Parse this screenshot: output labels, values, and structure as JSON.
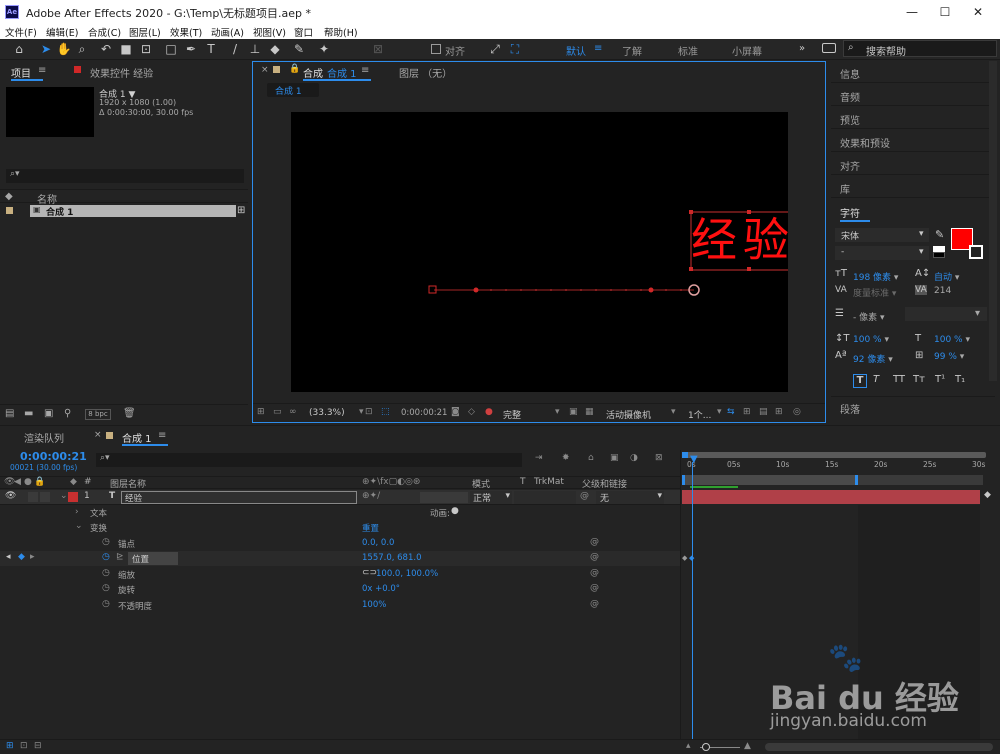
{
  "window": {
    "title": "Adobe After Effects 2020 - G:\\Temp\\无标题项目.aep *",
    "min": "—",
    "max": "☐",
    "close": "✕"
  },
  "menu": [
    "文件(F)",
    "编辑(E)",
    "合成(C)",
    "图层(L)",
    "效果(T)",
    "动画(A)",
    "视图(V)",
    "窗口",
    "帮助(H)"
  ],
  "toolbar": {
    "align_label": "对齐",
    "workspaces": [
      "默认",
      "了解",
      "标准",
      "小屏幕"
    ],
    "active_ws": "默认",
    "more": "»",
    "search_placeholder": "搜索帮助"
  },
  "project": {
    "tab": "项目",
    "tab2": "效果控件 经验",
    "comp_name": "合成 1 ▼",
    "comp_res": "1920 x 1080 (1.00)",
    "comp_dur": "Δ 0:00:30:00, 30.00 fps",
    "col_name": "名称",
    "item": "合成 1",
    "bpc": "8 bpc"
  },
  "comp": {
    "tab": "合成",
    "tab_name": "合成 1",
    "layer_tab": "图层 （无）",
    "breadcrumb": "合成 1",
    "text": "经验",
    "zoom": "(33.3%)",
    "timecode": "0:00:00:21",
    "quality": "完整",
    "camera": "活动摄像机",
    "views": "1个..."
  },
  "right_panels": [
    "信息",
    "音频",
    "预览",
    "效果和预设",
    "对齐",
    "库"
  ],
  "character": {
    "title": "字符",
    "font": "宋体",
    "style": "-",
    "size": "198 像素",
    "leading": "自动",
    "kerning": "度量标准",
    "tracking": "214",
    "stroke": "- 像素",
    "vscale": "100 %",
    "hscale": "100 %",
    "baseline": "92 像素",
    "tsume": "99 %",
    "fill_color": "#ff0000",
    "styles": [
      "T",
      "T",
      "TT",
      "Tт",
      "T¹",
      "T₁"
    ]
  },
  "paragraph": {
    "title": "段落"
  },
  "timeline": {
    "tab_render": "渲染队列",
    "tab_comp": "合成 1",
    "timecode": "0:00:00:21",
    "frames": "00021 (30.00 fps)",
    "col_num": "#",
    "col_layername": "图层名称",
    "col_mode": "模式",
    "col_t": "T",
    "col_trkmat": "TrkMat",
    "col_parent": "父级和链接",
    "ruler": [
      "0s",
      "05s",
      "10s",
      "15s",
      "20s",
      "25s",
      "30s"
    ]
  },
  "layer": {
    "num": "1",
    "type": "T",
    "name": "经验",
    "mode": "正常",
    "parent": "无",
    "text_group": "文本",
    "animate": "动画:",
    "transform": "变换",
    "reset": "重置"
  },
  "props": [
    {
      "name": "锚点",
      "value": "0.0, 0.0"
    },
    {
      "name": "位置",
      "value": "1557.0, 681.0"
    },
    {
      "name": "缩放",
      "value": "100.0, 100.0%"
    },
    {
      "name": "旋转",
      "value": "0x +0.0°"
    },
    {
      "name": "不透明度",
      "value": "100%"
    }
  ],
  "watermark": {
    "brand": "Bai du 经验",
    "url": "jingyan.baidu.com"
  }
}
